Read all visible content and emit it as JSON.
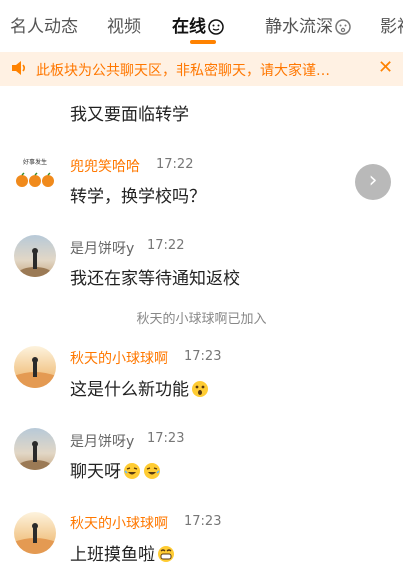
{
  "tabs": [
    {
      "label": "名人动态"
    },
    {
      "label": "视频"
    },
    {
      "label": "在线"
    },
    {
      "label": "静水流深"
    },
    {
      "label": "影视"
    }
  ],
  "notice": {
    "text": "此板块为公共聊天区，非私密聊天，请大家谨…"
  },
  "messages": [
    {
      "text": "我又要面临转学"
    },
    {
      "name": "兜兜笑哈哈",
      "time": "17:22",
      "text": "转学，换学校吗？"
    },
    {
      "name": "是月饼呀y",
      "time": "17:22",
      "text": "我还在家等待通知返校"
    },
    {
      "name": "秋天的小球球啊",
      "time": "17:23",
      "text": "这是什么新功能"
    },
    {
      "name": "是月饼呀y",
      "time": "17:23",
      "text": "聊天呀"
    },
    {
      "name": "秋天的小球球啊",
      "time": "17:23",
      "text": "上班摸鱼啦"
    }
  ],
  "system_message": "秋天的小球球啊已加入",
  "avatar_caption": "好事发生",
  "colors": {
    "accent": "#ff8200",
    "notice_bg": "#fff1e3",
    "name_orange": "#ff7800"
  }
}
